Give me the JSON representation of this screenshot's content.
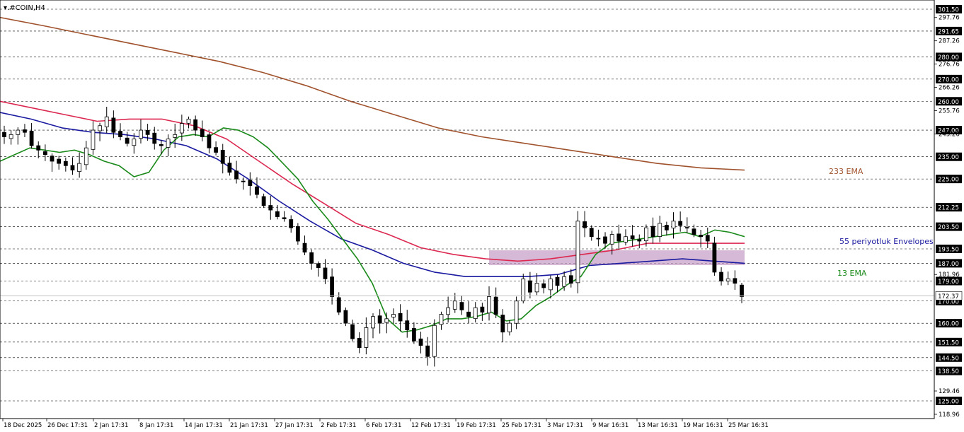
{
  "chart_title": "▾.#COIN,H4",
  "annotations": {
    "ema233": "233 EMA",
    "envelopes": "55 periyotluk Envelopes",
    "ema13": "13 EMA",
    "current_price": "172.37"
  },
  "colors": {
    "background": "#ffffff",
    "candle_up": "#ffffff",
    "candle_down": "#000000",
    "ema13": "#1a8a1a",
    "env_lower": "#1a1aa0",
    "env_upper": "#dc2850",
    "ema233": "#a0522d",
    "zone": "#c8a2c8",
    "grid": "#000000",
    "label_box": "#000000"
  },
  "chart_data": {
    "type": "candlestick",
    "symbol": "#COIN",
    "timeframe": "H4",
    "grid": true,
    "y_ticks": [
      "301.50",
      "297.76",
      "291.65",
      "287.26",
      "280.00",
      "276.76",
      "270.00",
      "266.26",
      "260.00",
      "255.76",
      "247.00",
      "245.26",
      "235.00",
      "225.00",
      "212.25",
      "203.50",
      "193.50",
      "187.00",
      "181.96",
      "179.00",
      "172.37",
      "170.00",
      "160.00",
      "151.50",
      "144.50",
      "138.50",
      "129.46",
      "125.00",
      "118.96"
    ],
    "boxed_levels": [
      301.5,
      291.65,
      280.0,
      270.0,
      260.0,
      247.0,
      235.0,
      225.0,
      212.25,
      203.5,
      193.5,
      187.0,
      179.0,
      170.0,
      160.0,
      151.5,
      144.5,
      138.5,
      125.0
    ],
    "current_price": 172.37,
    "x_labels": [
      "18 Dec 2025",
      "26 Dec 17:31",
      "2 Jan 17:31",
      "8 Jan 17:31",
      "14 Jan 17:31",
      "21 Jan 17:31",
      "27 Jan 17:31",
      "2 Feb 17:31",
      "6 Feb 17:31",
      "12 Feb 17:31",
      "19 Feb 17:31",
      "25 Feb 17:31",
      "3 Mar 17:31",
      "9 Mar 16:31",
      "13 Mar 16:31",
      "19 Mar 16:31",
      "25 Mar 16:31"
    ],
    "ohlc_close_path": [
      244,
      245,
      247,
      246,
      240,
      238,
      236,
      233,
      232,
      231,
      229,
      232,
      239,
      247,
      249,
      253,
      246,
      244,
      241,
      243,
      247,
      245,
      241,
      240,
      243,
      245,
      250,
      252,
      247,
      244,
      239,
      237,
      232,
      228,
      225,
      224,
      222,
      218,
      213,
      211,
      208,
      207,
      203,
      197,
      192,
      187,
      185,
      180,
      172,
      165,
      160,
      153,
      149,
      158,
      163,
      160,
      162,
      164,
      161,
      157,
      152,
      150,
      145,
      159,
      164,
      167,
      170,
      166,
      163,
      167,
      165,
      172,
      164,
      156,
      160,
      170,
      180,
      174,
      178,
      176,
      180,
      177,
      181,
      178,
      206,
      203,
      199,
      198,
      196,
      200,
      197,
      199,
      198,
      197,
      203,
      199,
      205,
      202,
      206,
      204,
      203,
      200,
      199,
      197,
      183,
      179,
      180,
      178,
      172
    ],
    "ema13": [
      233,
      236,
      239,
      238,
      237,
      238,
      236,
      233,
      231,
      226,
      228,
      238,
      244,
      245,
      244,
      248,
      247,
      244,
      239,
      232,
      225,
      215,
      207,
      198,
      189,
      178,
      162,
      156,
      157,
      159,
      162,
      162,
      163,
      165,
      161,
      162,
      168,
      172,
      177,
      181,
      191,
      196,
      197,
      198,
      199,
      200,
      201,
      199,
      202,
      201,
      199
    ],
    "envelope_upper": [
      260,
      257,
      254,
      251,
      252,
      252,
      249,
      243,
      233,
      223,
      214,
      205,
      200,
      194,
      191,
      189,
      188,
      189,
      191,
      193,
      196,
      196,
      196,
      196
    ],
    "envelope_lower": [
      255,
      252,
      248,
      246,
      245,
      243,
      240,
      234,
      225,
      215,
      206,
      198,
      193,
      187,
      183,
      181,
      181,
      181,
      182,
      186,
      187,
      188,
      189,
      188,
      187
    ],
    "ema233": [
      297.76,
      294,
      290,
      286,
      282,
      278,
      273,
      267,
      260,
      254,
      248,
      244,
      241,
      238,
      235,
      232,
      230,
      229
    ]
  }
}
